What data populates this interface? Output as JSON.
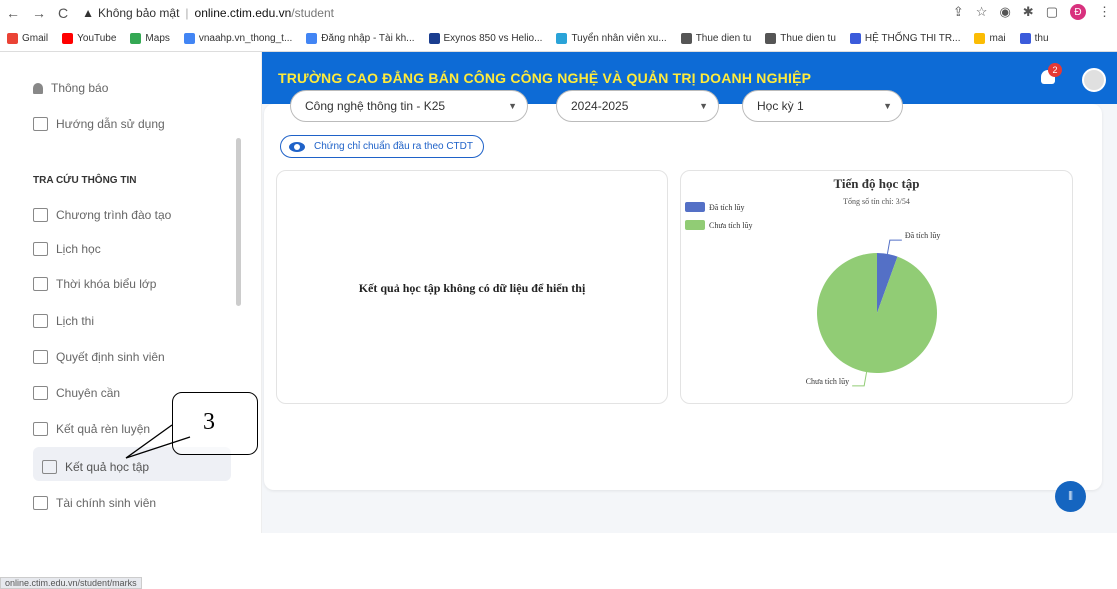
{
  "browser": {
    "security_label": "Không bảo mật",
    "url_host": "online.ctim.edu.vn",
    "url_path": "/student",
    "profile_initial": "Đ"
  },
  "bookmarks": [
    {
      "label": "Gmail",
      "color": "#ea4335"
    },
    {
      "label": "YouTube",
      "color": "#ff0000"
    },
    {
      "label": "Maps",
      "color": "#34a853"
    },
    {
      "label": "vnaahp.vn_thong_t...",
      "color": "#4285f4"
    },
    {
      "label": "Đăng nhập - Tài kh...",
      "color": "#4285f4"
    },
    {
      "label": "Exynos 850 vs Helio...",
      "color": "#1a3d8f"
    },
    {
      "label": "Tuyển nhân viên xu...",
      "color": "#2aa3d8"
    },
    {
      "label": "Thue dien tu",
      "color": "#555555"
    },
    {
      "label": "Thue dien tu",
      "color": "#555555"
    },
    {
      "label": "HỆ THỐNG THI TR...",
      "color": "#3b5bdb"
    },
    {
      "label": "mai",
      "color": "#fbbc04"
    },
    {
      "label": "thu",
      "color": "#3b5bdb"
    }
  ],
  "sidebar": {
    "top_items": [
      {
        "label": "Thông báo",
        "icon": "bell-icon"
      },
      {
        "label": "Hướng dẫn sử dụng",
        "icon": "guide-icon"
      }
    ],
    "section_title": "TRA CỨU THÔNG TIN",
    "items": [
      {
        "label": "Chương trình đào tạo",
        "icon": "curriculum-icon"
      },
      {
        "label": "Lịch học",
        "icon": "calendar-icon"
      },
      {
        "label": "Thời khóa biểu lớp",
        "icon": "timetable-icon"
      },
      {
        "label": "Lịch thi",
        "icon": "exam-calendar-icon"
      },
      {
        "label": "Quyết định sinh viên",
        "icon": "decision-icon"
      },
      {
        "label": "Chuyên cần",
        "icon": "attendance-icon"
      },
      {
        "label": "Kết quả rèn luyện",
        "icon": "conduct-icon"
      },
      {
        "label": "Kết quả học tập",
        "icon": "study-result-icon"
      },
      {
        "label": "Tài chính sinh viên",
        "icon": "finance-icon"
      }
    ],
    "active_label": "Kết quả học tập",
    "status_url": "online.ctim.edu.vn/student/marks"
  },
  "header": {
    "title": "TRƯỜNG CAO ĐẲNG BÁN CÔNG CÔNG NGHỆ VÀ QUẢN TRỊ DOANH NGHIỆP",
    "notification_count": "2"
  },
  "filters": {
    "program": "Công nghệ thông tin - K25",
    "year": "2024-2025",
    "semester": "Học kỳ 1"
  },
  "cert_button_label": "Chứng chỉ chuẩn đầu ra theo CTDT",
  "results_panel": {
    "empty_message": "Kết quả học tập không có dữ liệu để hiển thị"
  },
  "annotation_label": "3",
  "chart_data": {
    "type": "pie",
    "title": "Tiến độ học tập",
    "subtitle": "Tổng số tín chỉ: 3/54",
    "legend_position": "top-left",
    "categories": [
      "Đã tích lũy",
      "Chưa tích lũy"
    ],
    "values": [
      3,
      51
    ],
    "colors": [
      "#5470c6",
      "#91cc75"
    ]
  }
}
